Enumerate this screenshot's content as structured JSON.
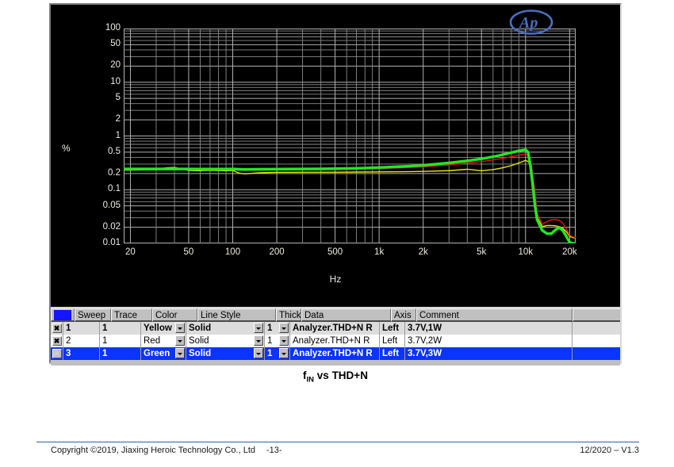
{
  "chart_data": {
    "type": "line",
    "title": "",
    "xlabel": "Hz",
    "ylabel": "%",
    "xscale": "log",
    "yscale": "log",
    "xlim": [
      18,
      22000
    ],
    "ylim": [
      0.01,
      100
    ],
    "grid": true,
    "legend_position": "none",
    "xticks": [
      "20",
      "50",
      "100",
      "200",
      "500",
      "1k",
      "2k",
      "5k",
      "10k",
      "20k"
    ],
    "xtick_values": [
      20,
      50,
      100,
      200,
      500,
      1000,
      2000,
      5000,
      10000,
      20000
    ],
    "yticks": [
      "0.01",
      "0.02",
      "0.05",
      "0.1",
      "0.2",
      "0.5",
      "1",
      "2",
      "5",
      "10",
      "20",
      "50",
      "100"
    ],
    "ytick_values": [
      0.01,
      0.02,
      0.05,
      0.1,
      0.2,
      0.5,
      1,
      2,
      5,
      10,
      20,
      50,
      100
    ],
    "annotations": [
      "Ap"
    ],
    "series": [
      {
        "name": "3.7V,1W",
        "color": "#e8e800",
        "x": [
          18,
          20,
          25,
          30,
          35,
          40,
          45,
          50,
          60,
          70,
          80,
          90,
          100,
          110,
          120,
          150,
          200,
          300,
          400,
          500,
          700,
          1000,
          1500,
          2000,
          3000,
          4000,
          5000,
          6000,
          7000,
          8000,
          9000,
          10000,
          10500,
          11000,
          11500,
          12000,
          13000,
          14000,
          15000,
          16000,
          17000,
          18000,
          19000,
          20000,
          21000,
          22000
        ],
        "values": [
          0.232,
          0.232,
          0.233,
          0.238,
          0.255,
          0.26,
          0.243,
          0.228,
          0.226,
          0.23,
          0.228,
          0.226,
          0.228,
          0.205,
          0.197,
          0.206,
          0.211,
          0.212,
          0.212,
          0.212,
          0.213,
          0.214,
          0.216,
          0.219,
          0.226,
          0.24,
          0.226,
          0.236,
          0.256,
          0.282,
          0.315,
          0.352,
          0.33,
          0.21,
          0.09,
          0.031,
          0.0205,
          0.0215,
          0.0215,
          0.0213,
          0.0205,
          0.019,
          0.0165,
          0.0135,
          0.0128,
          0.0128
        ]
      },
      {
        "name": "3.7V,2W",
        "color": "#e81414",
        "x": [
          18,
          20,
          25,
          30,
          35,
          40,
          50,
          60,
          70,
          80,
          90,
          100,
          110,
          120,
          150,
          200,
          300,
          400,
          500,
          700,
          1000,
          1500,
          2000,
          3000,
          4000,
          5000,
          6000,
          7000,
          8000,
          9000,
          10000,
          10500,
          11000,
          11500,
          12000,
          13000,
          14000,
          15000,
          16000,
          17000,
          18000,
          19000,
          20000,
          21000,
          22000
        ],
        "values": [
          0.236,
          0.236,
          0.236,
          0.239,
          0.24,
          0.24,
          0.236,
          0.236,
          0.238,
          0.236,
          0.234,
          0.239,
          0.234,
          0.23,
          0.232,
          0.234,
          0.235,
          0.236,
          0.238,
          0.242,
          0.248,
          0.257,
          0.266,
          0.29,
          0.314,
          0.333,
          0.358,
          0.385,
          0.412,
          0.438,
          0.462,
          0.43,
          0.27,
          0.11,
          0.036,
          0.0225,
          0.0255,
          0.0275,
          0.0278,
          0.0268,
          0.0238,
          0.0185,
          0.0142,
          0.0132,
          0.013
        ]
      },
      {
        "name": "3.7V,3W",
        "color": "#22e822",
        "x": [
          18,
          20,
          25,
          30,
          35,
          40,
          50,
          60,
          70,
          80,
          90,
          100,
          110,
          120,
          150,
          200,
          300,
          400,
          500,
          700,
          1000,
          1500,
          2000,
          3000,
          4000,
          5000,
          6000,
          7000,
          8000,
          9000,
          10000,
          10400,
          10800,
          11200,
          11600,
          12000,
          13000,
          14000,
          15000,
          16000,
          17000,
          18000,
          19000,
          20000,
          21000,
          22000
        ],
        "values": [
          0.243,
          0.243,
          0.243,
          0.243,
          0.243,
          0.243,
          0.243,
          0.242,
          0.242,
          0.242,
          0.242,
          0.243,
          0.24,
          0.238,
          0.24,
          0.241,
          0.243,
          0.244,
          0.246,
          0.25,
          0.258,
          0.272,
          0.285,
          0.315,
          0.345,
          0.375,
          0.41,
          0.45,
          0.49,
          0.53,
          0.555,
          0.5,
          0.28,
          0.12,
          0.05,
          0.0275,
          0.0175,
          0.0152,
          0.0152,
          0.0178,
          0.0196,
          0.0172,
          0.0135,
          0.0105,
          0.0098,
          0.0098
        ]
      }
    ]
  },
  "plot": {
    "y_axis_title": "%",
    "x_axis_title": "Hz",
    "logo_label": "Ap"
  },
  "sweep_table": {
    "headers": {
      "swatch": "",
      "sweep": "Sweep",
      "trace": "Trace",
      "color": "Color",
      "line_style": "Line Style",
      "thick": "Thick",
      "data": "Data",
      "axis": "Axis",
      "comment": "Comment",
      "last": ""
    },
    "rows": [
      {
        "close": "✖",
        "sweep": "1",
        "trace": "1",
        "color": "Yellow",
        "line_style": "Solid",
        "thick": "1",
        "data": "Analyzer.THD+N R",
        "axis": "Left",
        "comment": "3.7V,1W"
      },
      {
        "close": "✖",
        "sweep": "2",
        "trace": "1",
        "color": "Red",
        "line_style": "Solid",
        "thick": "1",
        "data": "Analyzer.THD+N R",
        "axis": "Left",
        "comment": "3.7V,2W"
      },
      {
        "close": "✖",
        "sweep": "3",
        "trace": "1",
        "color": "Green",
        "line_style": "Solid",
        "thick": "1",
        "data": "Analyzer.THD+N R",
        "axis": "Left",
        "comment": "3.7V,3W"
      }
    ]
  },
  "caption": {
    "prefix": "f",
    "subscript": "IN",
    "suffix": " vs THD+N"
  },
  "footer": {
    "copyright": "Copyright ©2019, Jiaxing Heroic Technology Co., Ltd",
    "page": "-13-",
    "version": "12/2020 – V1.3"
  },
  "colors": {
    "accent_blue": "#2e5fa3",
    "selection_blue": "#0a34ff",
    "plot_bg": "#000000",
    "grid": "#9a9a9a"
  }
}
